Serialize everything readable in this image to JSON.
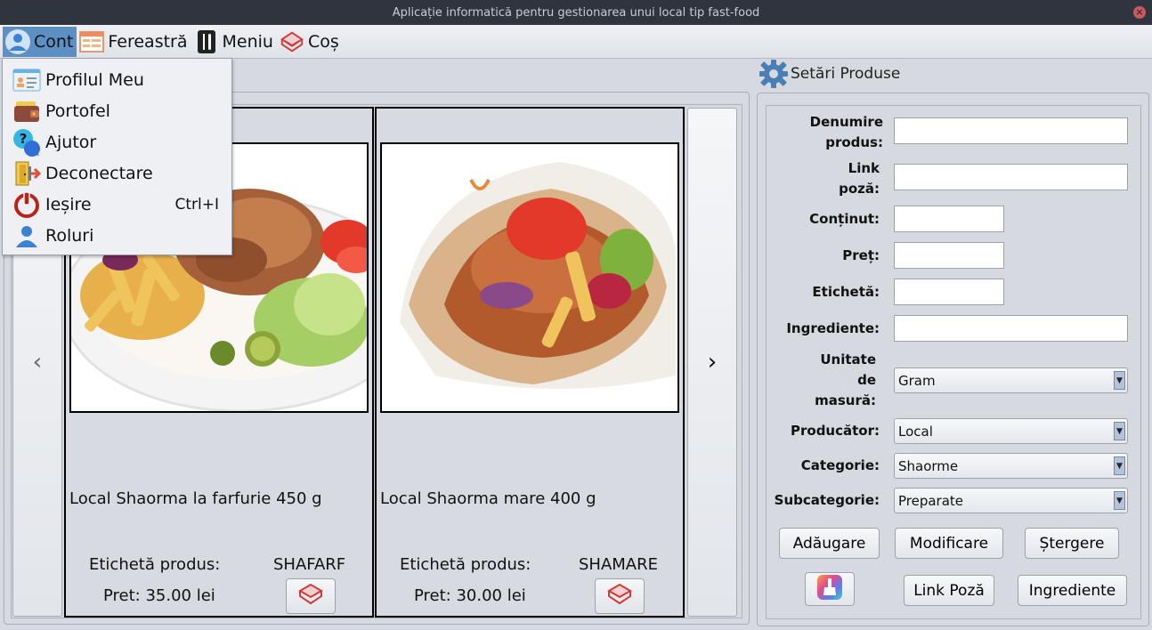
{
  "window": {
    "title": "Aplicație informatică pentru gestionarea unui local tip fast-food",
    "close_glyph": "×"
  },
  "menubar": {
    "items": [
      {
        "label": "Cont",
        "icon": "user-icon"
      },
      {
        "label": "Fereastră",
        "icon": "window-icon"
      },
      {
        "label": "Meniu",
        "icon": "utensils-icon"
      },
      {
        "label": "Coș",
        "icon": "basket-icon"
      }
    ]
  },
  "dropdown": {
    "items": [
      {
        "label": "Profilul Meu",
        "icon": "profile-card-icon",
        "shortcut": ""
      },
      {
        "label": "Portofel",
        "icon": "wallet-icon",
        "shortcut": ""
      },
      {
        "label": "Ajutor",
        "icon": "help-icon",
        "shortcut": ""
      },
      {
        "label": "Deconectare",
        "icon": "logout-door-icon",
        "shortcut": ""
      },
      {
        "label": "Ieșire",
        "icon": "power-icon",
        "shortcut": "Ctrl+I"
      },
      {
        "label": "Roluri",
        "icon": "user-icon",
        "shortcut": ""
      }
    ]
  },
  "products": {
    "prev_glyph": "‹",
    "next_glyph": "›",
    "cards": [
      {
        "name": "Local Shaorma la farfurie 450 g",
        "tag_label": "Etichetă produs:",
        "tag": "SHAFARF",
        "price": "Pret: 35.00 lei",
        "image": "plate-shawarma-photo"
      },
      {
        "name": "Local Shaorma mare 400 g",
        "tag_label": "Etichetă produs:",
        "tag": "SHAMARE",
        "price": "Pret: 30.00 lei",
        "image": "wrap-shawarma-photo"
      }
    ]
  },
  "settings": {
    "title": "Setări Produse",
    "fields": {
      "denumire_label_1": "Denumire",
      "denumire_label_2": "produs:",
      "link_label_1": "Link",
      "link_label_2": "poză:",
      "continut_label": "Conținut:",
      "pret_label": "Preț:",
      "eticheta_label": "Etichetă:",
      "ingrediente_label": "Ingrediente:",
      "unitate_label_1": "Unitate",
      "unitate_label_2": "de",
      "unitate_label_3": "masură:",
      "producator_label": "Producător:",
      "categorie_label": "Categorie:",
      "subcategorie_label": "Subcategorie:"
    },
    "values": {
      "denumire": "",
      "link": "",
      "continut": "",
      "pret": "",
      "eticheta": "",
      "ingrediente": "",
      "unitate": "Gram",
      "producator": "Local",
      "categorie": "Shaorme",
      "subcategorie": "Preparate"
    },
    "buttons": {
      "add": "Adăugare",
      "modify": "Modificare",
      "delete": "Ștergere",
      "link_photo": "Link Poză",
      "ingredients": "Ingrediente"
    }
  }
}
